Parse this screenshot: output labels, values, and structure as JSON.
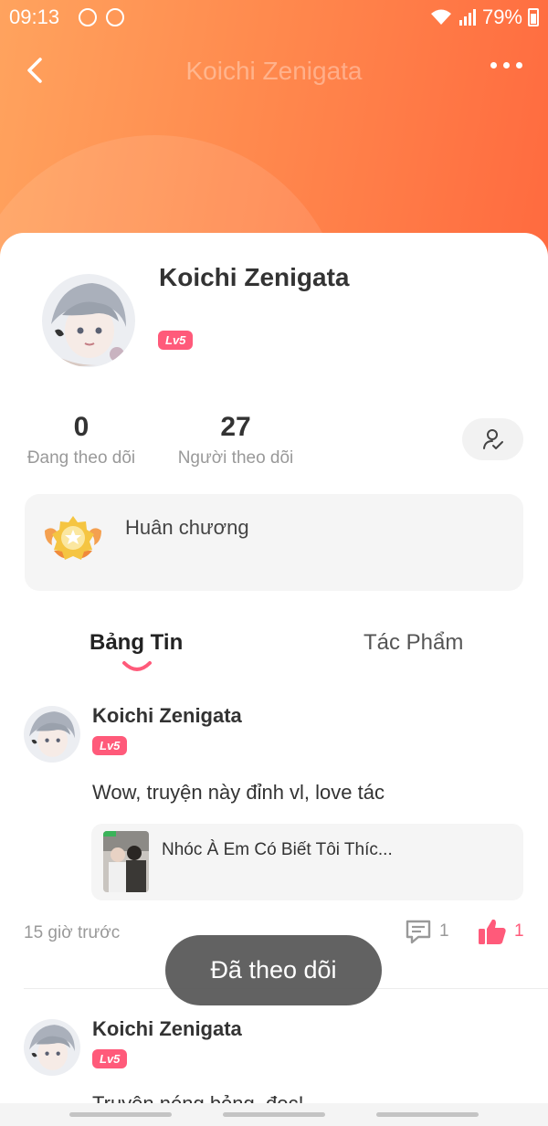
{
  "status_bar": {
    "time": "09:13",
    "battery": "79%"
  },
  "nav": {
    "title": "Koichi Zenigata"
  },
  "profile": {
    "name": "Koichi Zenigata",
    "level": "Lv5",
    "following_count": "0",
    "following_label": "Đang theo dõi",
    "followers_count": "27",
    "followers_label": "Người theo dõi",
    "medal_label": "Huân chương"
  },
  "tabs": [
    {
      "label": "Bảng Tin",
      "active": true
    },
    {
      "label": "Tác Phẩm",
      "active": false
    }
  ],
  "posts": [
    {
      "author": "Koichi Zenigata",
      "level": "Lv5",
      "text": "Wow, truyện này đỉnh vl, love tác",
      "story_title": "Nhóc À Em Có Biết Tôi Thíc...",
      "time": "15 giờ trước",
      "comments": "1",
      "likes": "1"
    },
    {
      "author": "Koichi Zenigata",
      "level": "Lv5",
      "text": "Truyện nóng bỏng, đọc!"
    }
  ],
  "toast": "Đã theo dõi",
  "colors": {
    "accent": "#ff5a7a",
    "header_gradient": [
      "#ffa35e",
      "#ff6a3f"
    ]
  }
}
